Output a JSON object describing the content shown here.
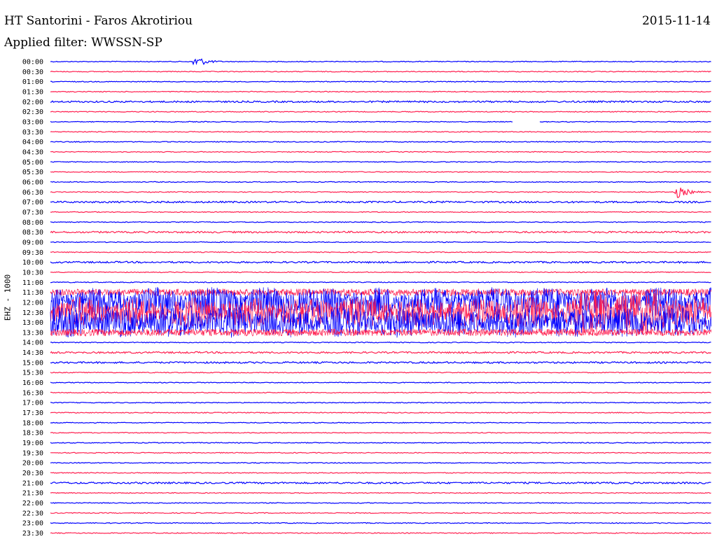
{
  "header": {
    "station": "HT Santorini - Faros Akrotiriou",
    "date": "2015-11-14",
    "filter_text": "Applied filter: WWSSN-SP"
  },
  "channel_label": "EHZ - 1000",
  "colors": {
    "trace_a": "#0000ff",
    "trace_b": "#ff1f4f"
  },
  "chart_data": {
    "type": "helicorder",
    "title": "HT Santorini - Faros Akrotiriou",
    "date": "2015-11-14",
    "filter": "WWSSN-SP",
    "ylabel": "EHZ - 1000",
    "row_interval_minutes": 30,
    "row_colors_alternate": [
      "#0000ff",
      "#ff1f4f"
    ],
    "rows": [
      {
        "time": "00:00",
        "color": "blue",
        "activity": "quiet",
        "event_at": 0.22
      },
      {
        "time": "00:30",
        "color": "red",
        "activity": "quiet"
      },
      {
        "time": "01:00",
        "color": "blue",
        "activity": "quiet"
      },
      {
        "time": "01:30",
        "color": "red",
        "activity": "quiet"
      },
      {
        "time": "02:00",
        "color": "blue",
        "activity": "low"
      },
      {
        "time": "02:30",
        "color": "red",
        "activity": "quiet"
      },
      {
        "time": "03:00",
        "color": "blue",
        "activity": "quiet",
        "gap_at": 0.72
      },
      {
        "time": "03:30",
        "color": "red",
        "activity": "quiet"
      },
      {
        "time": "04:00",
        "color": "blue",
        "activity": "quiet"
      },
      {
        "time": "04:30",
        "color": "red",
        "activity": "quiet"
      },
      {
        "time": "05:00",
        "color": "blue",
        "activity": "quiet"
      },
      {
        "time": "05:30",
        "color": "red",
        "activity": "quiet"
      },
      {
        "time": "06:00",
        "color": "blue",
        "activity": "quiet"
      },
      {
        "time": "06:30",
        "color": "red",
        "activity": "quiet",
        "event_at": 0.95
      },
      {
        "time": "07:00",
        "color": "blue",
        "activity": "low"
      },
      {
        "time": "07:30",
        "color": "red",
        "activity": "quiet"
      },
      {
        "time": "08:00",
        "color": "blue",
        "activity": "quiet"
      },
      {
        "time": "08:30",
        "color": "red",
        "activity": "low"
      },
      {
        "time": "09:00",
        "color": "blue",
        "activity": "quiet"
      },
      {
        "time": "09:30",
        "color": "red",
        "activity": "quiet"
      },
      {
        "time": "10:00",
        "color": "blue",
        "activity": "low"
      },
      {
        "time": "10:30",
        "color": "red",
        "activity": "quiet"
      },
      {
        "time": "11:00",
        "color": "blue",
        "activity": "quiet"
      },
      {
        "time": "11:30",
        "color": "red",
        "activity": "noisy"
      },
      {
        "time": "12:00",
        "color": "blue",
        "activity": "high"
      },
      {
        "time": "12:30",
        "color": "red",
        "activity": "high"
      },
      {
        "time": "13:00",
        "color": "blue",
        "activity": "high"
      },
      {
        "time": "13:30",
        "color": "red",
        "activity": "noisy"
      },
      {
        "time": "14:00",
        "color": "blue",
        "activity": "quiet"
      },
      {
        "time": "14:30",
        "color": "red",
        "activity": "low"
      },
      {
        "time": "15:00",
        "color": "blue",
        "activity": "low"
      },
      {
        "time": "15:30",
        "color": "red",
        "activity": "quiet"
      },
      {
        "time": "16:00",
        "color": "blue",
        "activity": "quiet"
      },
      {
        "time": "16:30",
        "color": "red",
        "activity": "quiet"
      },
      {
        "time": "17:00",
        "color": "blue",
        "activity": "quiet"
      },
      {
        "time": "17:30",
        "color": "red",
        "activity": "quiet"
      },
      {
        "time": "18:00",
        "color": "blue",
        "activity": "quiet"
      },
      {
        "time": "18:30",
        "color": "red",
        "activity": "quiet"
      },
      {
        "time": "19:00",
        "color": "blue",
        "activity": "quiet"
      },
      {
        "time": "19:30",
        "color": "red",
        "activity": "quiet"
      },
      {
        "time": "20:00",
        "color": "blue",
        "activity": "quiet"
      },
      {
        "time": "20:30",
        "color": "red",
        "activity": "quiet"
      },
      {
        "time": "21:00",
        "color": "blue",
        "activity": "low"
      },
      {
        "time": "21:30",
        "color": "red",
        "activity": "quiet"
      },
      {
        "time": "22:00",
        "color": "blue",
        "activity": "quiet"
      },
      {
        "time": "22:30",
        "color": "red",
        "activity": "quiet"
      },
      {
        "time": "23:00",
        "color": "blue",
        "activity": "quiet"
      },
      {
        "time": "23:30",
        "color": "red",
        "activity": "quiet"
      }
    ]
  }
}
